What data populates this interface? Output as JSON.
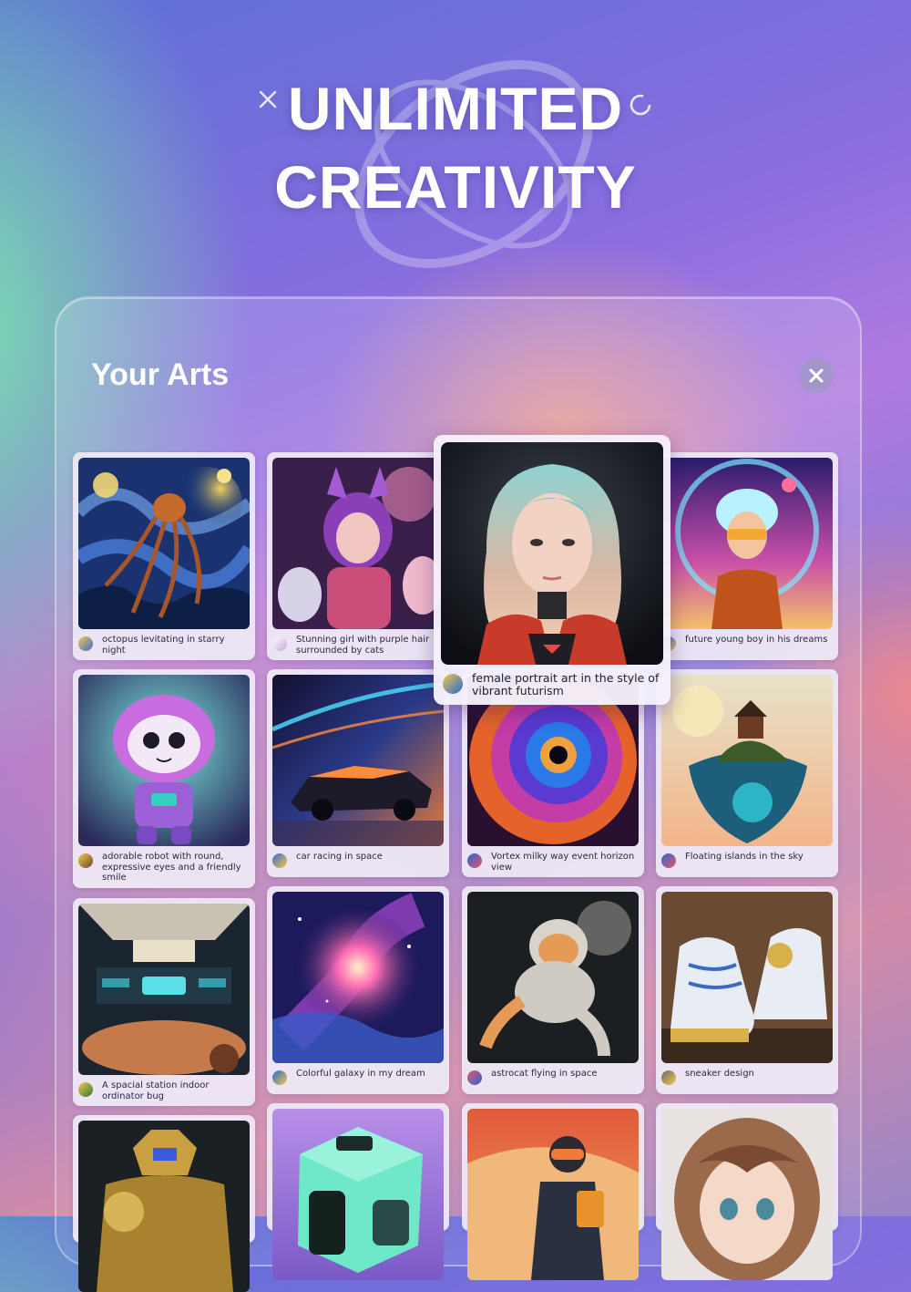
{
  "header": {
    "line1": "UNLIMITED",
    "line2": "CREATIVITY"
  },
  "panel": {
    "title": "Your Arts",
    "close_icon": "close-icon"
  },
  "colors": {
    "accent": "#a37be0",
    "card_bg": "#eee8f6",
    "text": "#2a2840"
  },
  "arts": [
    {
      "caption": "octopus levitating in starry night",
      "theme": "starry-night"
    },
    {
      "caption": "Stunning girl with purple hair surrounded by cats",
      "theme": "purple-girl"
    },
    {
      "caption": "future young boy in his dreams",
      "theme": "future-boy"
    },
    {
      "caption": "adorable robot with round, expressive eyes and a friendly smile",
      "theme": "robot"
    },
    {
      "caption": "car racing in space",
      "theme": "space-car"
    },
    {
      "caption": "Vortex milky way event horizon view",
      "theme": "vortex"
    },
    {
      "caption": "Floating islands in the sky",
      "theme": "floating-island"
    },
    {
      "caption": "A spacial station indoor ordinator bug",
      "theme": "space-station"
    },
    {
      "caption": "Colorful galaxy in my dream",
      "theme": "galaxy"
    },
    {
      "caption": "astrocat flying in space",
      "theme": "astrocat"
    },
    {
      "caption": "sneaker design",
      "theme": "sneaker"
    },
    {
      "caption": "",
      "theme": "gold-robot"
    },
    {
      "caption": "",
      "theme": "green-cube"
    },
    {
      "caption": "",
      "theme": "astronaut-desert"
    },
    {
      "caption": "",
      "theme": "doll-girl"
    }
  ],
  "featured": {
    "caption": "female portrait art in the style of vibrant futurism",
    "theme": "futurism-portrait"
  }
}
